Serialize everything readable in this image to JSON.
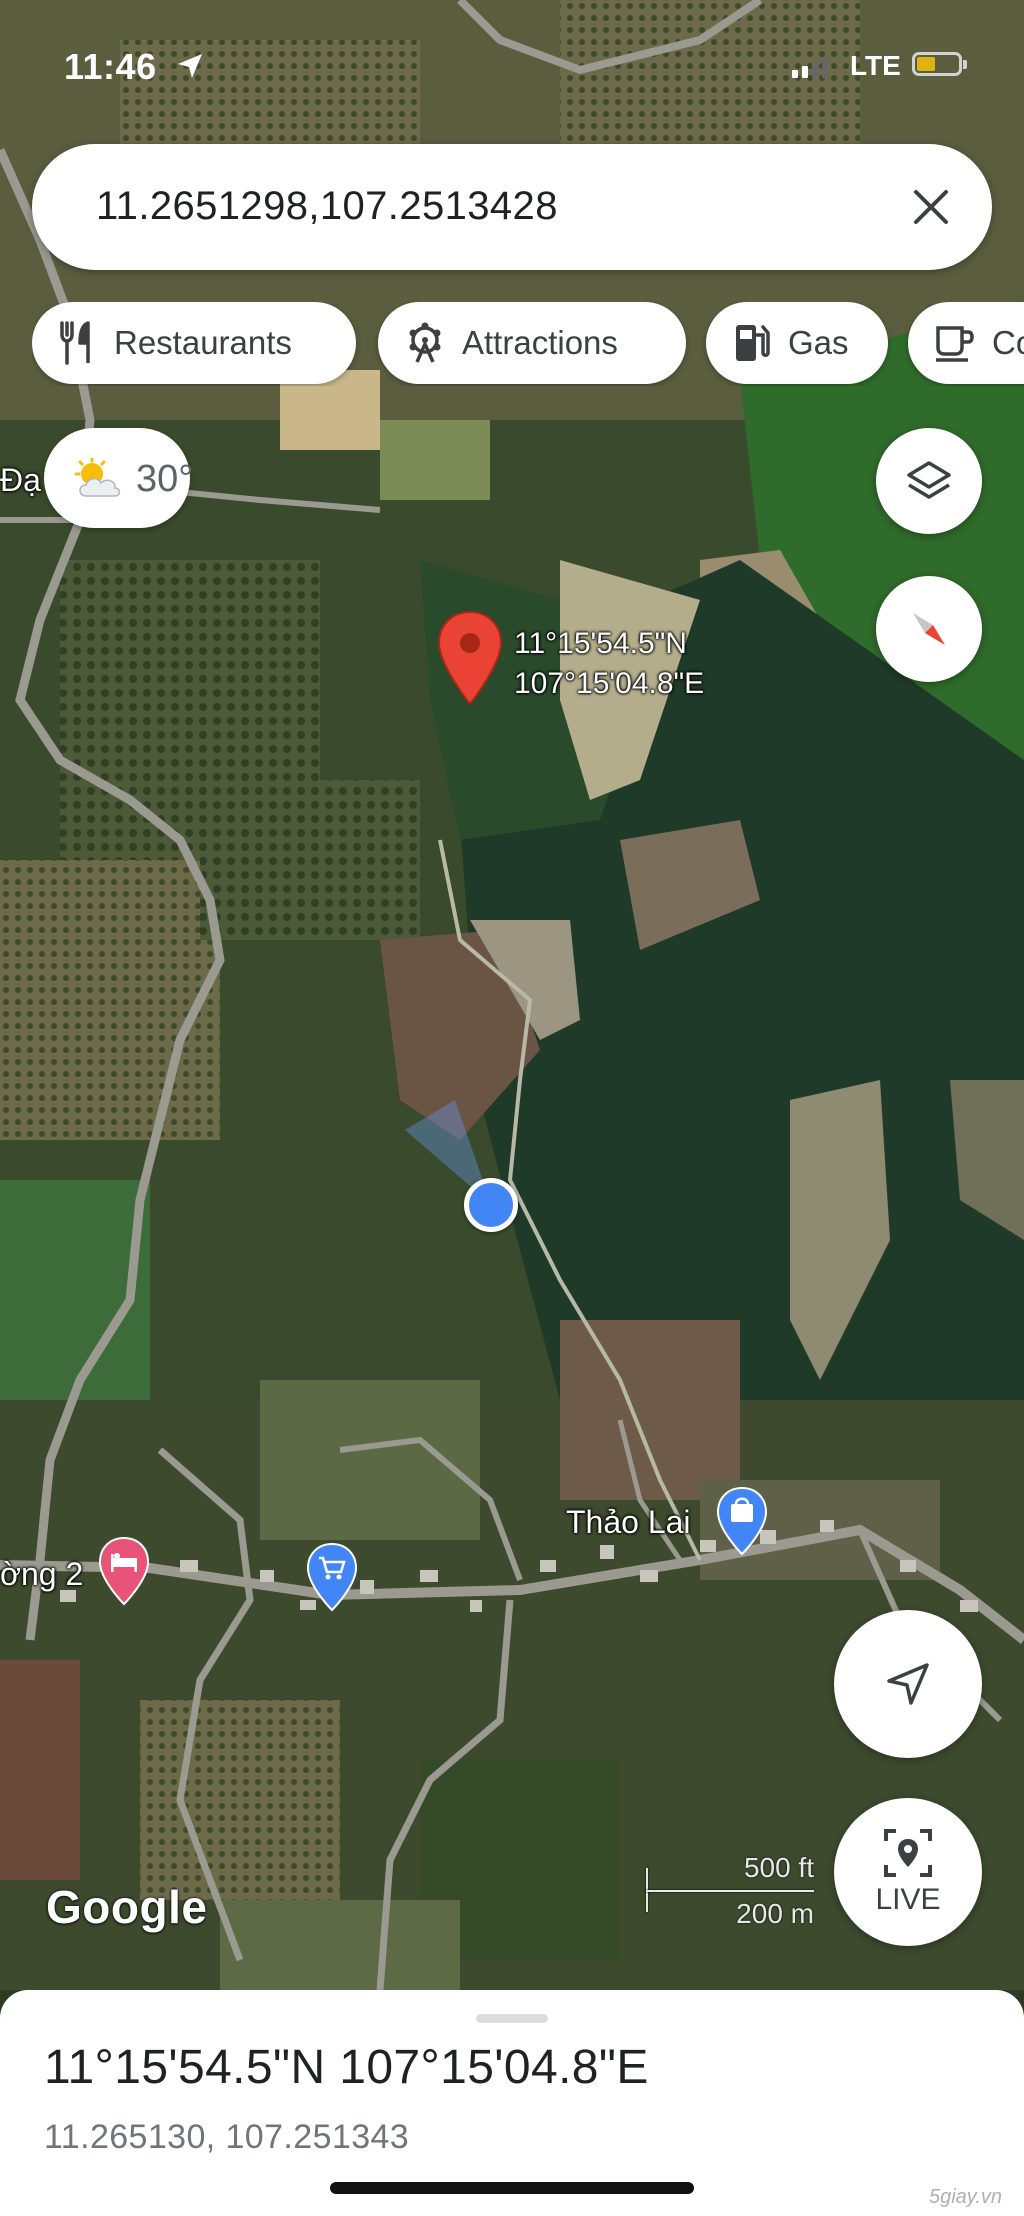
{
  "status_bar": {
    "time": "11:46",
    "network": "LTE"
  },
  "search": {
    "query": "11.2651298,107.2513428",
    "close_icon": "close-icon"
  },
  "chips": [
    {
      "label": "Restaurants",
      "icon": "fork-knife-icon"
    },
    {
      "label": "Attractions",
      "icon": "ferris-wheel-icon"
    },
    {
      "label": "Gas",
      "icon": "gas-pump-icon"
    },
    {
      "label": "Co",
      "icon": "coffee-cup-icon"
    }
  ],
  "weather": {
    "temp": "30°",
    "icon": "partly-cloudy-icon"
  },
  "map": {
    "pin_lat": "11°15'54.5\"N",
    "pin_lng": "107°15'04.8\"E",
    "place_labels": {
      "village": "Thảo Lai",
      "road_left": "ờng 2",
      "edge_left": "Đạ"
    },
    "attribution": "Google",
    "scale": {
      "imperial": "500 ft",
      "metric": "200 m"
    }
  },
  "controls": {
    "live_label": "LIVE"
  },
  "sheet": {
    "title": "11°15'54.5\"N 107°15'04.8\"E",
    "subtitle": "11.265130, 107.251343",
    "watermark": "5giay.vn"
  },
  "colors": {
    "pin_red": "#ea4335",
    "blue_dot": "#4285f4",
    "poi_blue": "#4285f4",
    "hotel_pink": "#e8537a"
  }
}
